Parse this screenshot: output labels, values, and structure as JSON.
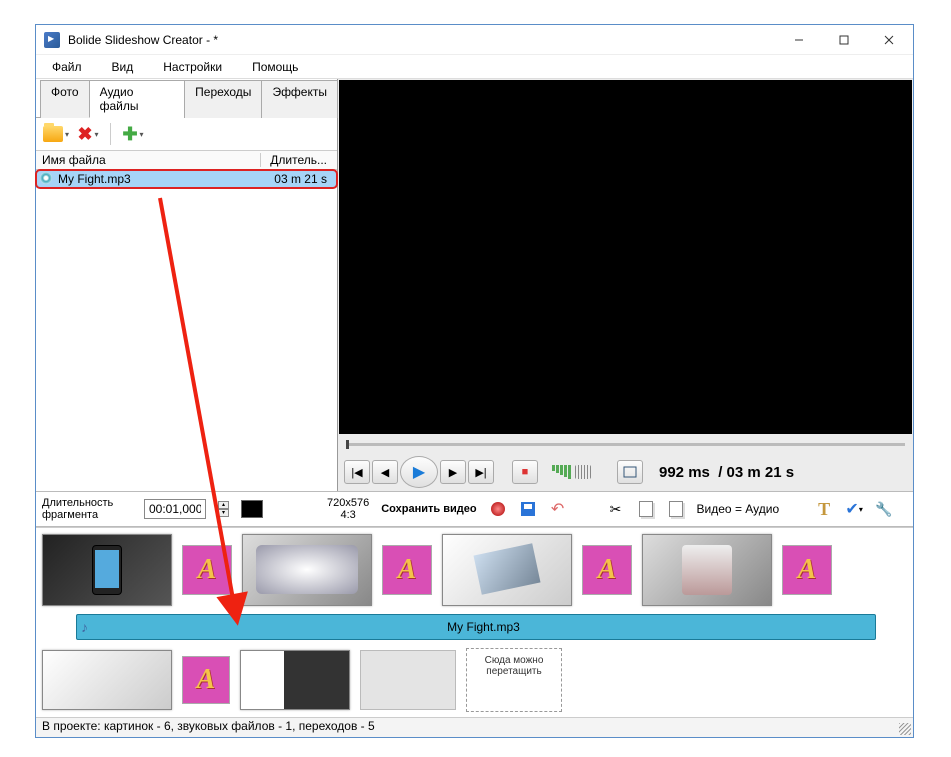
{
  "window": {
    "title": "Bolide Slideshow Creator - *"
  },
  "menu": {
    "file": "Файл",
    "view": "Вид",
    "settings": "Настройки",
    "help": "Помощь"
  },
  "tabs": {
    "photo": "Фото",
    "audio": "Аудио файлы",
    "transitions": "Переходы",
    "effects": "Эффекты"
  },
  "list": {
    "col_name": "Имя файла",
    "col_dur": "Длитель...",
    "row": {
      "name": "My Fight.mp3",
      "duration": "03 m 21 s"
    }
  },
  "playback": {
    "position": "992 ms",
    "total": "/ 03 m 21 s"
  },
  "midbar": {
    "frag_label": "Длительность фрагмента",
    "frag_time": "00:01,000",
    "dim": "720x576",
    "ratio": "4:3",
    "save": "Сохранить видео",
    "va": "Видео = Аудио"
  },
  "audio_track": {
    "filename": "My Fight.mp3"
  },
  "drop": {
    "line1": "Сюда можно",
    "line2": "перетащить"
  },
  "status": "В проекте: картинок - 6, звуковых файлов - 1, переходов - 5"
}
